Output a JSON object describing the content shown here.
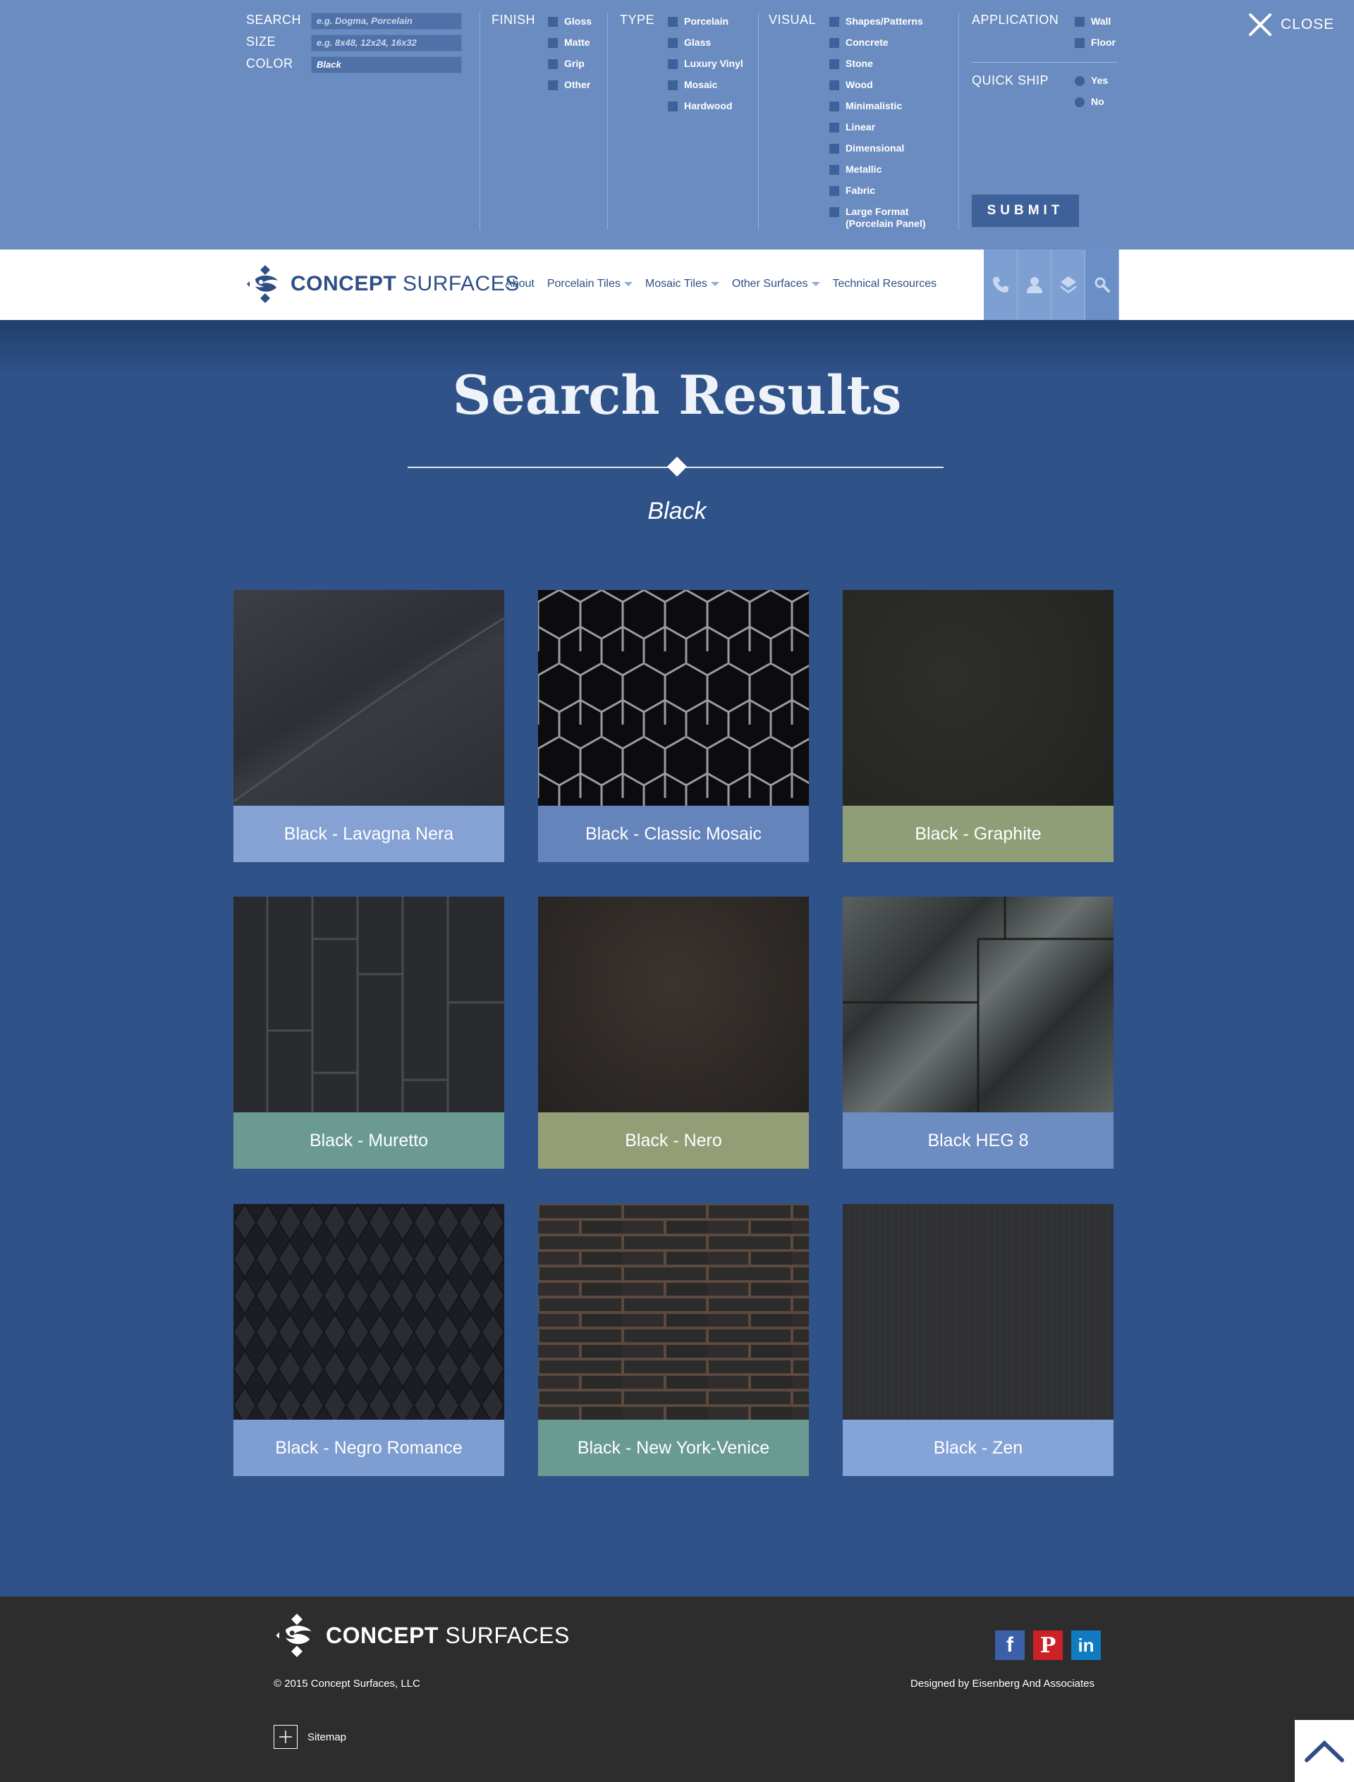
{
  "search_panel": {
    "search_label": "SEARCH",
    "search_placeholder": "e.g. Dogma, Porcelain",
    "size_label": "SIZE",
    "size_placeholder": "e.g. 8x48, 12x24, 16x32",
    "color_label": "COLOR",
    "color_value": "Black",
    "finish": {
      "title": "FINISH",
      "options": [
        "Gloss",
        "Matte",
        "Grip",
        "Other"
      ]
    },
    "type": {
      "title": "TYPE",
      "options": [
        "Porcelain",
        "Glass",
        "Luxury Vinyl",
        "Mosaic",
        "Hardwood"
      ]
    },
    "visual": {
      "title": "VISUAL",
      "options": [
        "Shapes/Patterns",
        "Concrete",
        "Stone",
        "Wood",
        "Minimalistic",
        "Linear",
        "Dimensional",
        "Metallic",
        "Fabric",
        "Large Format (Porcelain Panel)"
      ]
    },
    "application": {
      "title": "APPLICATION",
      "options": [
        "Wall",
        "Floor"
      ]
    },
    "quick_ship": {
      "title": "QUICK SHIP",
      "options": [
        "Yes",
        "No"
      ]
    },
    "submit_label": "SUBMIT",
    "close_label": "CLOSE"
  },
  "nav": {
    "logo_bold": "CONCEPT",
    "logo_light": " SURFACES",
    "links": [
      "About",
      "Porcelain Tiles",
      "Mosaic Tiles",
      "Other Surfaces",
      "Technical Resources"
    ],
    "icons": [
      "phone-icon",
      "user-icon",
      "layers-icon",
      "search-icon"
    ]
  },
  "main": {
    "title": "Search Results",
    "search_term": "Black",
    "results": [
      {
        "label": "Black - Lavagna Nera",
        "color": "#86a2d4"
      },
      {
        "label": "Black - Classic Mosaic",
        "color": "#6584bb"
      },
      {
        "label": "Black - Graphite",
        "color": "#8f9e76"
      },
      {
        "label": "Black - Muretto",
        "color": "#6a9a92"
      },
      {
        "label": "Black - Nero",
        "color": "#939d76"
      },
      {
        "label": "Black HEG 8",
        "color": "#6d8cc1"
      },
      {
        "label": "Black - Negro Romance",
        "color": "#7e9dd1"
      },
      {
        "label": "Black - New York-Venice",
        "color": "#6a9b93"
      },
      {
        "label": "Black - Zen",
        "color": "#84a3d6"
      }
    ]
  },
  "footer": {
    "logo_bold": "CONCEPT",
    "logo_light": " SURFACES",
    "copyright": "© 2015 Concept Surfaces, LLC",
    "designed_by": "Designed by Eisenberg And Associates",
    "sitemap": "Sitemap",
    "social": [
      {
        "icon": "facebook-icon",
        "glyph": "f",
        "color": "#3b5fa8"
      },
      {
        "icon": "pinterest-icon",
        "glyph": "P",
        "color": "#cc2127"
      },
      {
        "icon": "linkedin-icon",
        "glyph": "in",
        "color": "#0f7bc0"
      }
    ]
  },
  "colors": {
    "panel": "#6b8cc0",
    "page_bg": "#2f5289",
    "brand": "#2e4f86",
    "footer": "#2d2d2e"
  }
}
